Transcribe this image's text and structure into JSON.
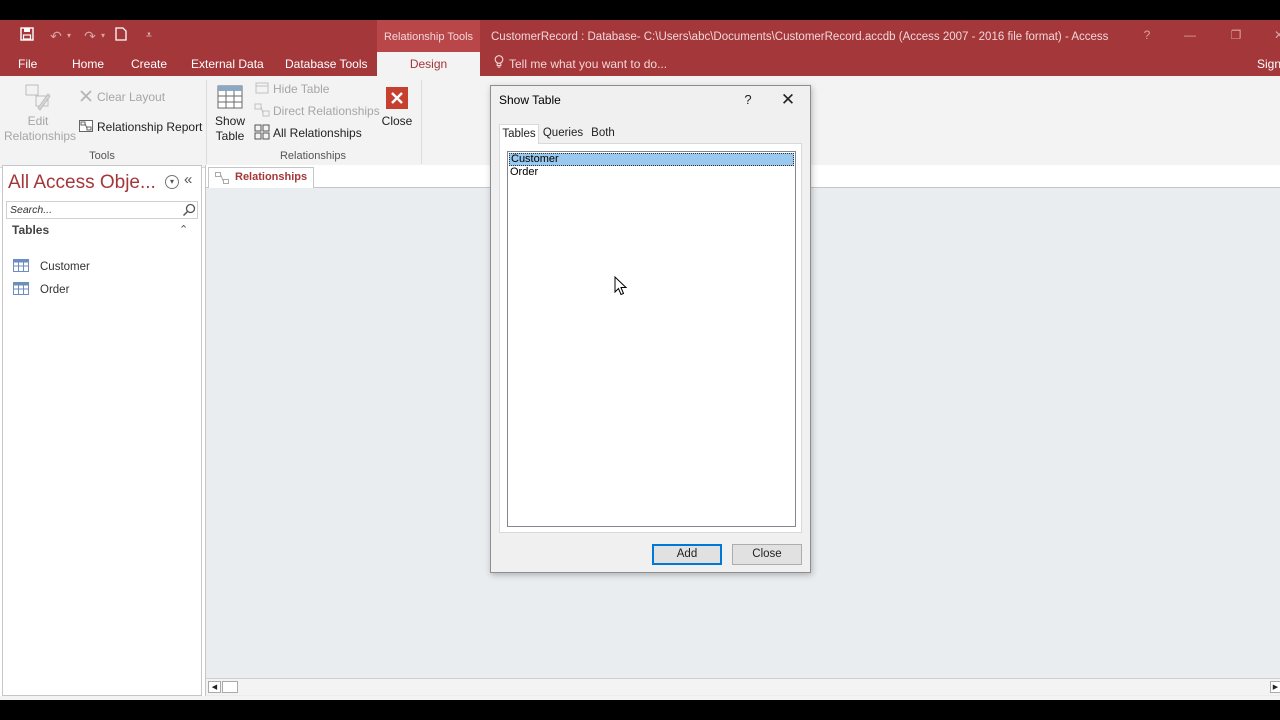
{
  "window": {
    "context_tab_group": "Relationship Tools",
    "title": "CustomerRecord : Database- C:\\Users\\abc\\Documents\\CustomerRecord.accdb (Access 2007 - 2016 file format) - Access"
  },
  "quick_access": {
    "icons": [
      "save-icon",
      "undo-icon",
      "redo-icon",
      "new-file-icon",
      "customize-qat-icon"
    ]
  },
  "ribbon_tabs": {
    "file": "File",
    "home": "Home",
    "create": "Create",
    "external_data": "External Data",
    "database_tools": "Database Tools",
    "design": "Design",
    "tell_me": "Tell me what you want to do...",
    "sign_in": "Sign"
  },
  "ribbon": {
    "tools": {
      "label": "Tools",
      "edit_relationships": [
        "Edit",
        "Relationships"
      ],
      "clear_layout": "Clear Layout",
      "relationship_report": "Relationship Report"
    },
    "relationships": {
      "label": "Relationships",
      "show_table": [
        "Show",
        "Table"
      ],
      "hide_table": "Hide Table",
      "direct_relationships": "Direct Relationships",
      "all_relationships": "All Relationships",
      "close": "Close"
    }
  },
  "nav_pane": {
    "title": "All Access Obje...",
    "search_placeholder": "Search...",
    "section": "Tables",
    "items": [
      {
        "label": "Customer",
        "icon": "table-icon"
      },
      {
        "label": "Order",
        "icon": "table-icon"
      }
    ]
  },
  "document": {
    "tab_label": "Relationships"
  },
  "dialog": {
    "title": "Show Table",
    "help": "?",
    "tabs": [
      "Tables",
      "Queries",
      "Both"
    ],
    "active_tab": "Tables",
    "list": [
      "Customer",
      "Order"
    ],
    "selected": "Customer",
    "add_button": "Add",
    "close_button": "Close"
  },
  "colors": {
    "accent": "#a4373a",
    "selection": "#99c9ef",
    "default_button_border": "#0078d7"
  }
}
